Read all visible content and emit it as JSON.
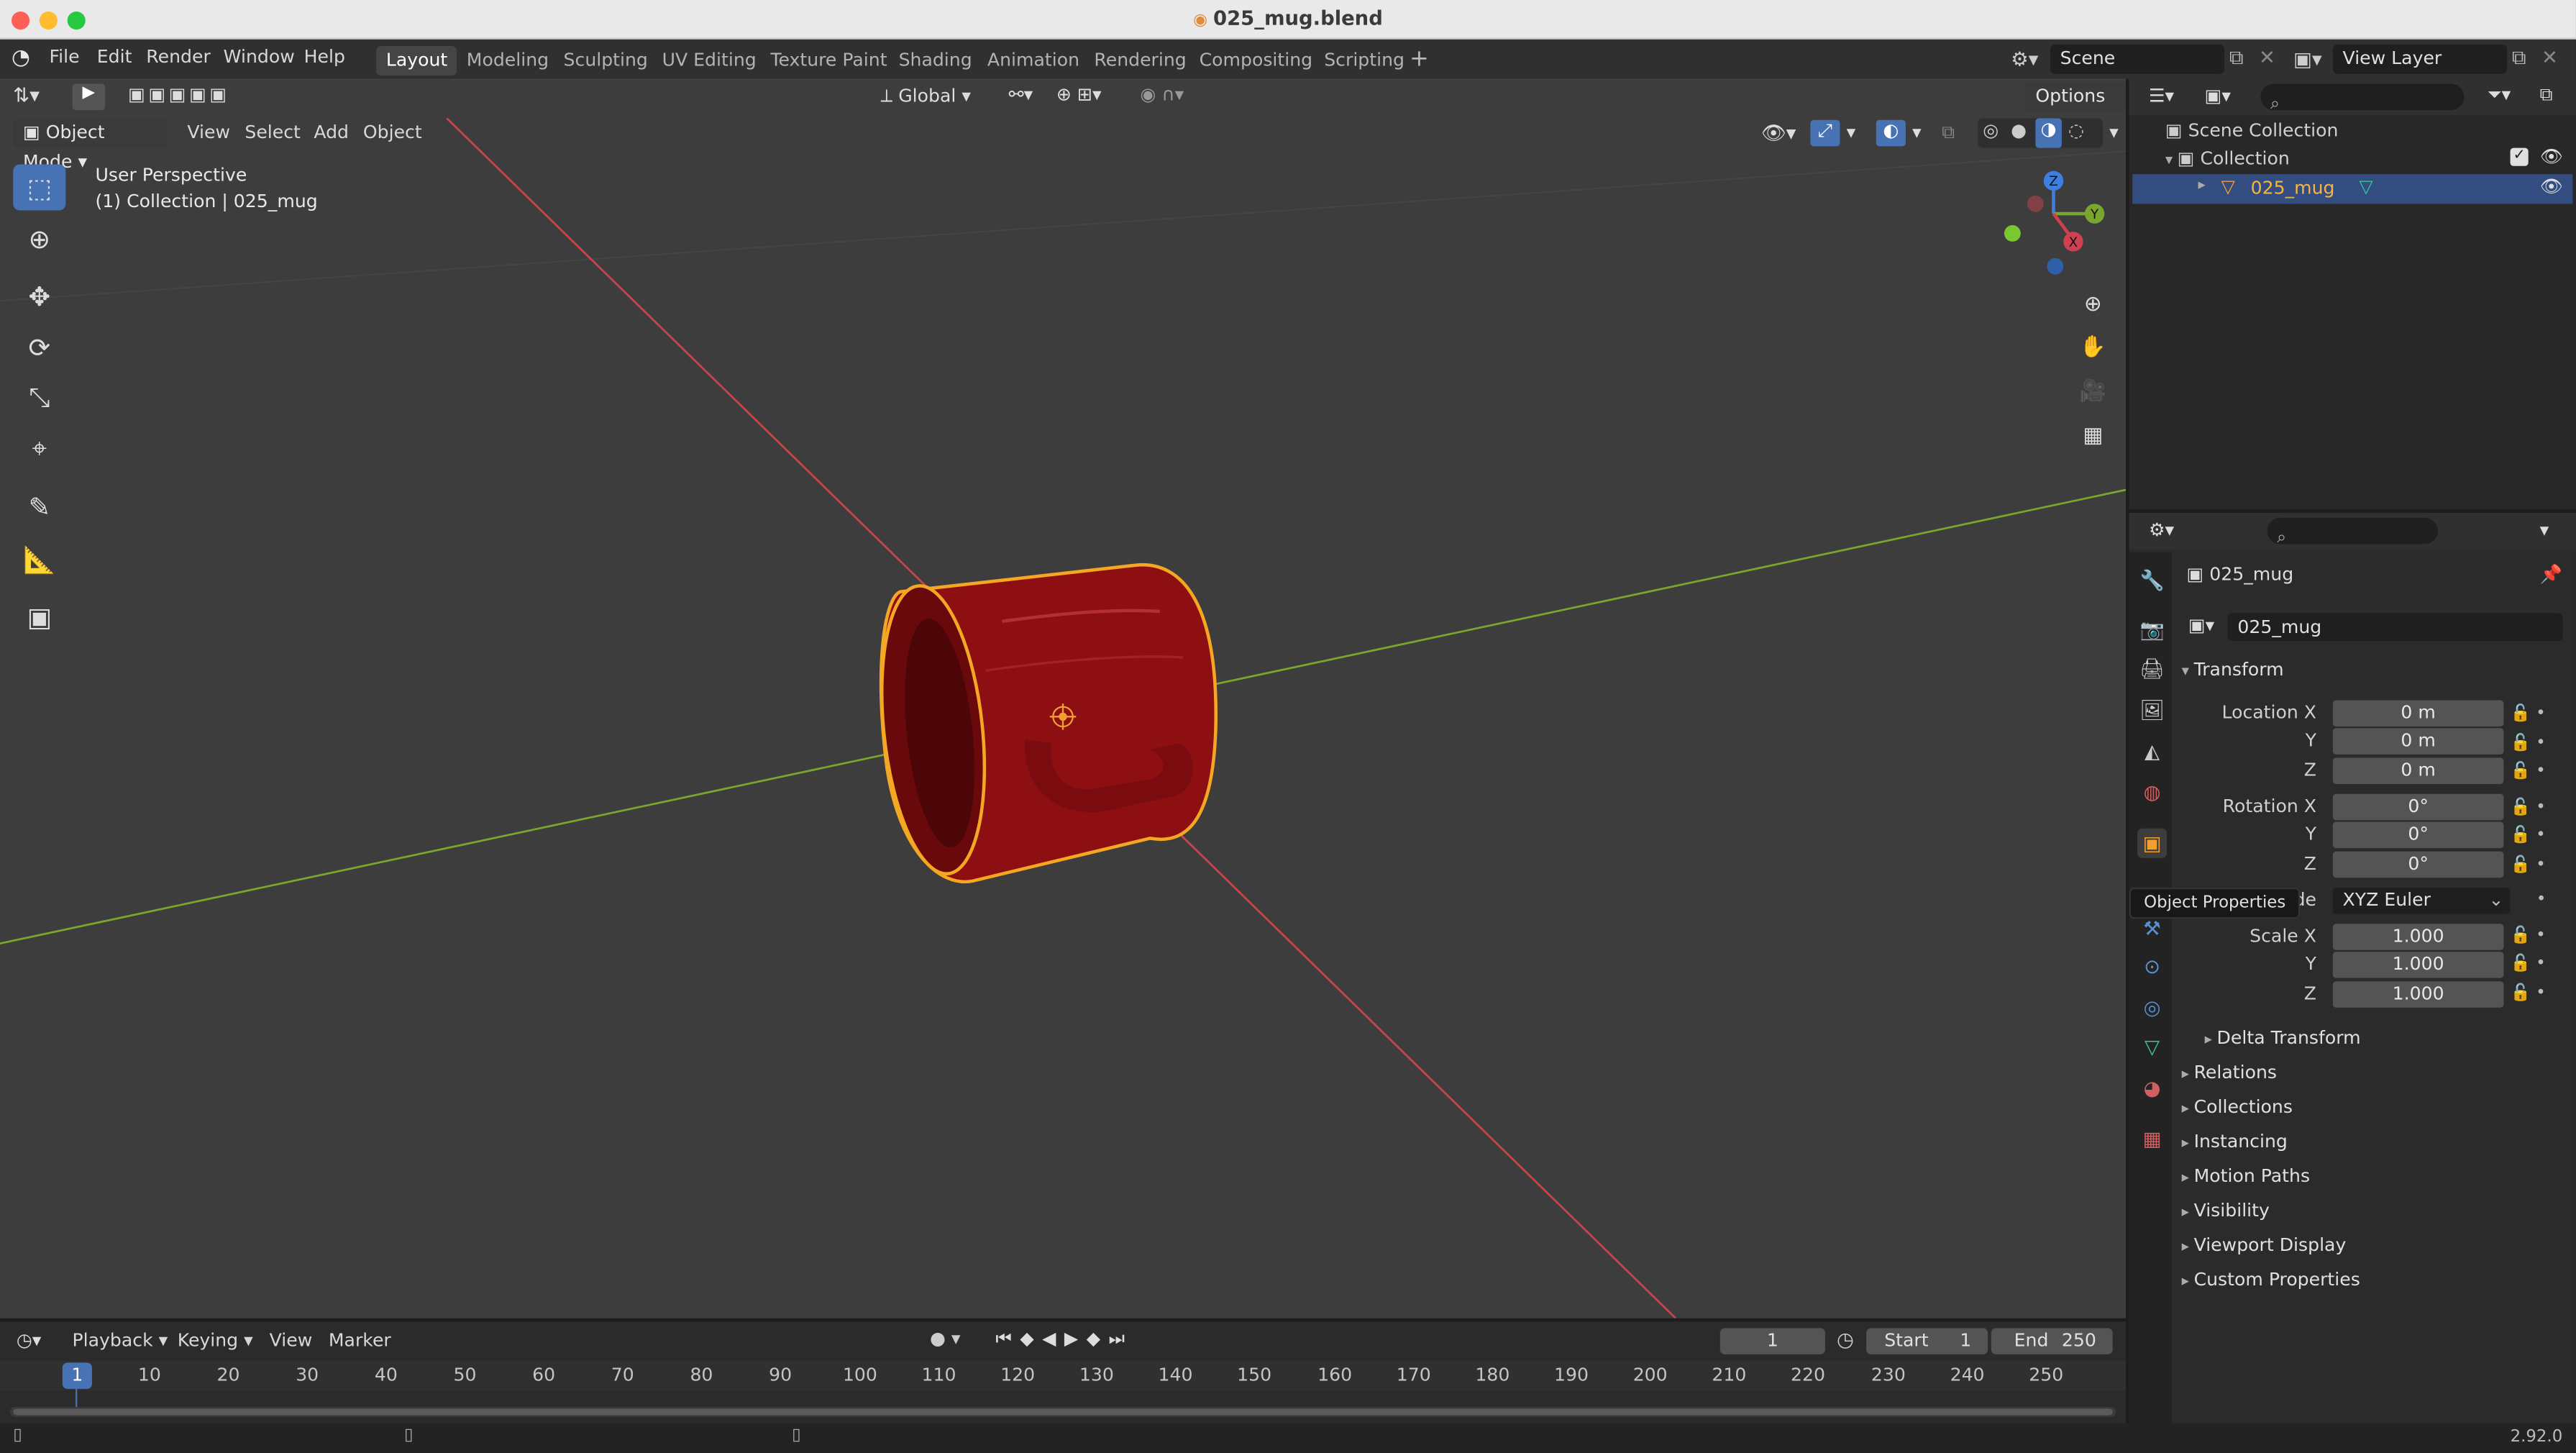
{
  "window": {
    "title": "025_mug.blend"
  },
  "menu": [
    "File",
    "Edit",
    "Render",
    "Window",
    "Help"
  ],
  "workspaces": [
    "Layout",
    "Modeling",
    "Sculpting",
    "UV Editing",
    "Texture Paint",
    "Shading",
    "Animation",
    "Rendering",
    "Compositing",
    "Scripting"
  ],
  "active_workspace": "Layout",
  "scene": {
    "name": "Scene",
    "view_layer": "View Layer"
  },
  "viewport": {
    "mode": "Object Mode",
    "menus": [
      "View",
      "Select",
      "Add",
      "Object"
    ],
    "orientation": "Global",
    "options_label": "Options",
    "perspective_label": "User Perspective",
    "collection_label": "(1) Collection | 025_mug",
    "gizmo_axes": {
      "z": "Z",
      "y": "Y",
      "x": "X"
    }
  },
  "outliner": {
    "scene_collection": "Scene Collection",
    "collection": "Collection",
    "object": "025_mug"
  },
  "properties": {
    "object_name": "025_mug",
    "data_name": "025_mug",
    "tooltip": "Object Properties",
    "transform_label": "Transform",
    "location_label": "Location X",
    "rotation_label": "Rotation X",
    "mode_label": "de",
    "scale_label": "Scale X",
    "axis_y": "Y",
    "axis_z": "Z",
    "location": [
      "0 m",
      "0 m",
      "0 m"
    ],
    "rotation": [
      "0°",
      "0°",
      "0°"
    ],
    "rotation_mode": "XYZ Euler",
    "scale": [
      "1.000",
      "1.000",
      "1.000"
    ],
    "delta_transform": "Delta Transform",
    "panels": [
      "Relations",
      "Collections",
      "Instancing",
      "Motion Paths",
      "Visibility",
      "Viewport Display",
      "Custom Properties"
    ]
  },
  "timeline": {
    "menus": [
      "Playback",
      "Keying",
      "View",
      "Marker"
    ],
    "current_frame": "1",
    "start_label": "Start",
    "start": "1",
    "end_label": "End",
    "end": "250",
    "ruler": [
      "1",
      "10",
      "20",
      "30",
      "40",
      "50",
      "60",
      "70",
      "80",
      "90",
      "100",
      "110",
      "120",
      "130",
      "140",
      "150",
      "160",
      "170",
      "180",
      "190",
      "200",
      "210",
      "220",
      "230",
      "240",
      "250"
    ]
  },
  "status": {
    "version": "2.92.0"
  },
  "colors": {
    "accent": "#4772b3",
    "selection_outline": "#f5a623",
    "mug": "#8e0f12",
    "x_axis": "#c8454d",
    "y_axis": "#7aa52e"
  }
}
